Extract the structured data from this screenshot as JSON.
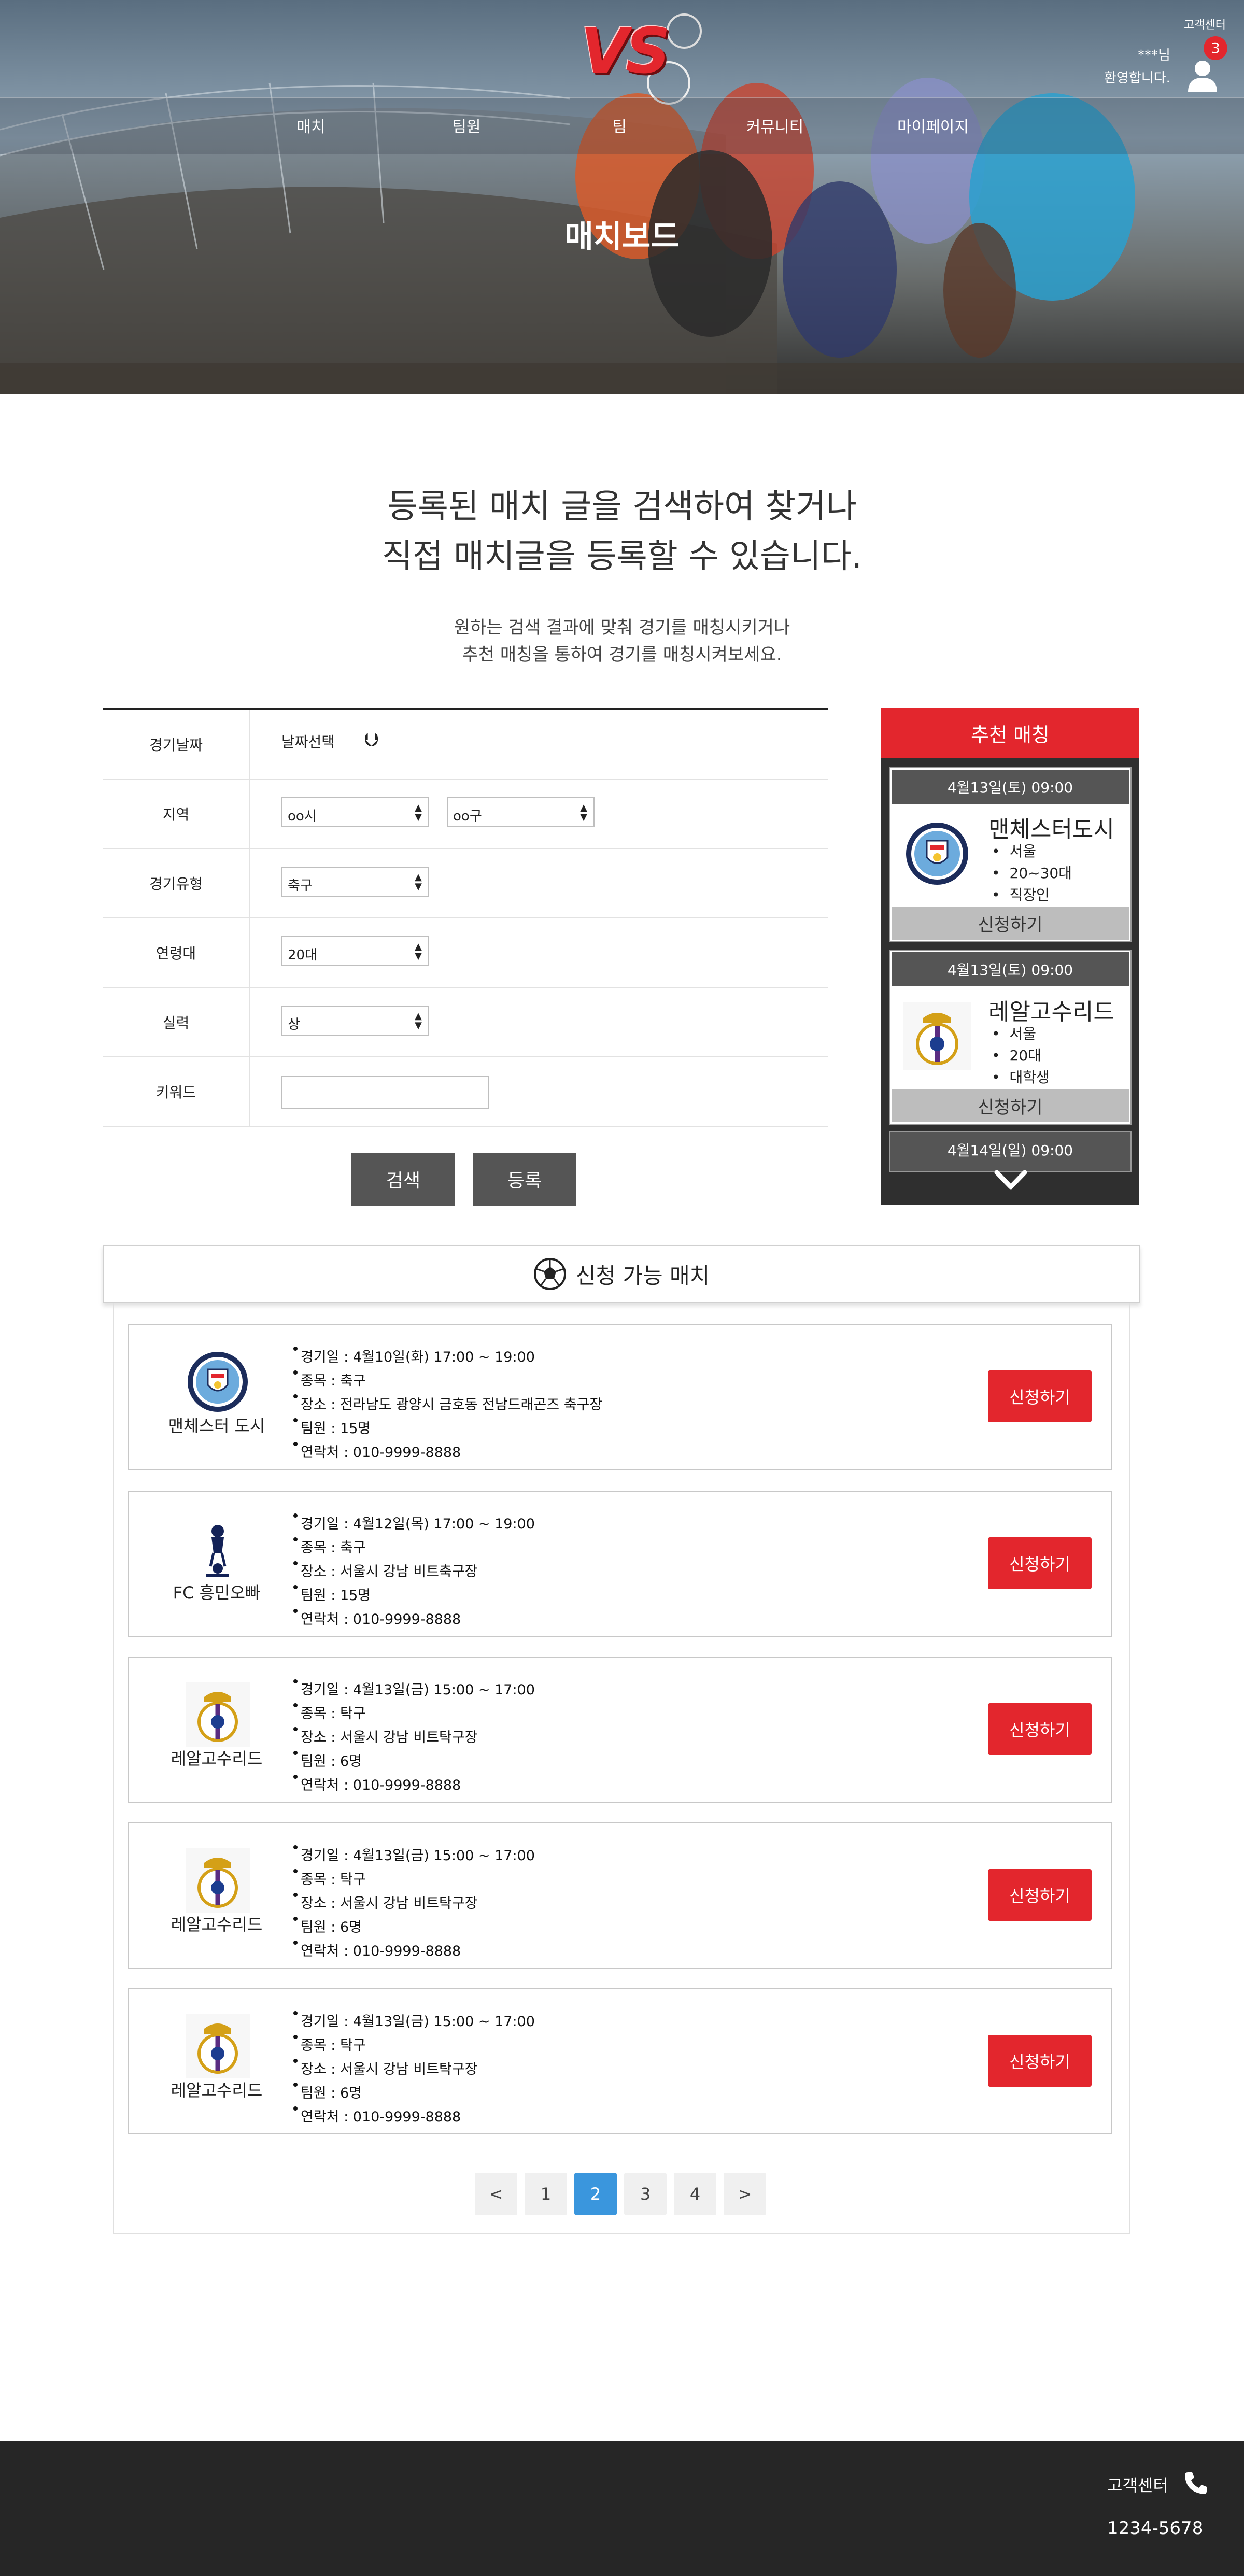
{
  "header": {
    "logo_text": "VS",
    "customer_center_small": "고객센터",
    "user_line1": "***님",
    "user_line2": "환영합니다.",
    "notification_count": "3",
    "nav": [
      "매치",
      "팀원",
      "팀",
      "커뮤니티",
      "마이페이지"
    ],
    "hero_title": "매치보드"
  },
  "intro": {
    "heading_line1": "등록된 매치 글을 검색하여 찾거나",
    "heading_line2": "직접 매치글을 등록할 수 있습니다.",
    "sub_line1": "원하는 검색 결과에 맞춰 경기를 매칭시키거나",
    "sub_line2": "추천 매칭을 통하여 경기를 매칭시켜보세요."
  },
  "search": {
    "date_label": "경기날짜",
    "date_value": "날짜선택",
    "region_label": "지역",
    "city_value": "oo시",
    "district_value": "oo구",
    "type_label": "경기유형",
    "type_value": "축구",
    "age_label": "연령대",
    "age_value": "20대",
    "skill_label": "실력",
    "skill_value": "상",
    "keyword_label": "키워드",
    "keyword_value": "",
    "search_button": "검색",
    "register_button": "등록"
  },
  "recommend": {
    "title": "추천 매칭",
    "cards": [
      {
        "date": "4월13일(토) 09:00",
        "team": "맨체스터도시",
        "details": [
          "서울",
          "20~30대",
          "직장인"
        ],
        "apply": "신청하기",
        "logo": "man-city-crest"
      },
      {
        "date": "4월13일(토) 09:00",
        "team": "레알고수리드",
        "details": [
          "서울",
          "20대",
          "대학생"
        ],
        "apply": "신청하기",
        "logo": "real-madrid-crest"
      }
    ],
    "peek_date": "4월14일(일) 09:00"
  },
  "available": {
    "title": "신청 가능 매치",
    "icon": "soccer-ball-icon",
    "matches": [
      {
        "team": "맨체스터 도시",
        "logo": "man-city-crest",
        "date": "경기일 : 4월10일(화) 17:00 ~ 19:00",
        "sport": "종목 : 축구",
        "place": "장소 : 전라남도 광양시 금호동 전남드래곤즈 축구장",
        "members": "팀원 : 15명",
        "contact": "연락처 : 010-9999-8888",
        "apply": "신청하기"
      },
      {
        "team": "FC 흥민오빠",
        "logo": "tottenham-crest",
        "date": "경기일 : 4월12일(목) 17:00 ~ 19:00",
        "sport": "종목 : 축구",
        "place": "장소 : 서울시 강남 비트축구장",
        "members": "팀원 : 15명",
        "contact": "연락처 : 010-9999-8888",
        "apply": "신청하기"
      },
      {
        "team": "레알고수리드",
        "logo": "real-madrid-crest",
        "date": "경기일 : 4월13일(금) 15:00 ~ 17:00",
        "sport": "종목 : 탁구",
        "place": "장소 : 서울시 강남 비트탁구장",
        "members": "팀원 : 6명",
        "contact": "연락처 : 010-9999-8888",
        "apply": "신청하기"
      },
      {
        "team": "레알고수리드",
        "logo": "real-madrid-crest",
        "date": "경기일 : 4월13일(금) 15:00 ~ 17:00",
        "sport": "종목 : 탁구",
        "place": "장소 : 서울시 강남 비트탁구장",
        "members": "팀원 : 6명",
        "contact": "연락처 : 010-9999-8888",
        "apply": "신청하기"
      },
      {
        "team": "레알고수리드",
        "logo": "real-madrid-crest",
        "date": "경기일 : 4월13일(금) 15:00 ~ 17:00",
        "sport": "종목 : 탁구",
        "place": "장소 : 서울시 강남 비트탁구장",
        "members": "팀원 : 6명",
        "contact": "연락처 : 010-9999-8888",
        "apply": "신청하기"
      }
    ]
  },
  "pagination": {
    "prev": "<",
    "pages": [
      "1",
      "2",
      "3",
      "4"
    ],
    "current": "2",
    "next": ">"
  },
  "footer": {
    "customer_center": "고객센터",
    "phone": "1234-5678"
  },
  "colors": {
    "accent": "#e3262d",
    "dark": "#2f2f2f",
    "page_active": "#3a96dd",
    "footer": "#262626"
  }
}
